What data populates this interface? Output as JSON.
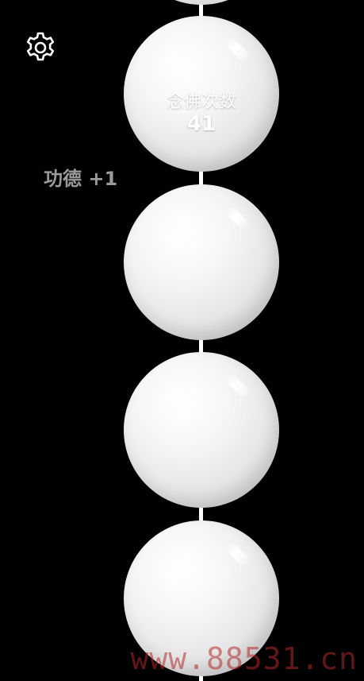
{
  "counter": {
    "label": "念佛次数",
    "value": "41"
  },
  "merit_popup": "功德 +1",
  "settings_icon": "gear-icon",
  "watermark": "www.88531.cn",
  "colors": {
    "background": "#000000",
    "bead": "#f2f2f2",
    "string": "#ffffff",
    "merit_text": "#9a9a9a",
    "watermark": "#b42828"
  }
}
